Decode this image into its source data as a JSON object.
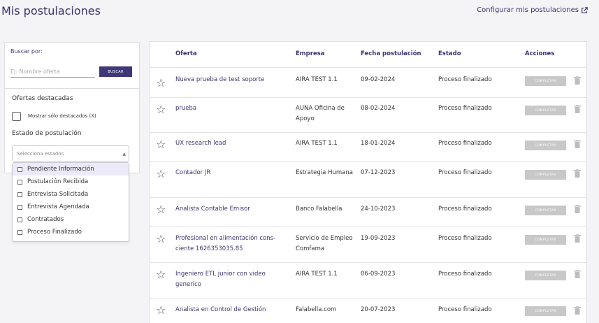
{
  "page": {
    "title": "Mis postulaciones",
    "config_link": "Configurar mis postulaciones"
  },
  "filters": {
    "search_label": "Buscar por:",
    "search_placeholder": "Ej: Nombre oferta",
    "search_button": "BUSCAR",
    "featured_title": "Ofertas destacadas",
    "featured_checkbox_label": "Mostrar sólo destacados (X)",
    "state_title": "Estado de postulación",
    "state_placeholder": "Selecciona estados",
    "state_options": [
      "Pendiente Información",
      "Postulación Recibida",
      "Entrevista Solicitada",
      "Entrevista Agendada",
      "Contratados",
      "Proceso Finalizado"
    ]
  },
  "table": {
    "headers": {
      "offer": "Oferta",
      "company": "Empresa",
      "date": "Fecha postulación",
      "state": "Estado",
      "actions": "Acciones"
    },
    "action_label": "COMPLETAR",
    "rows": [
      {
        "offer": "Nueva prueba de test soporte",
        "company": "AIRA TEST 1.1",
        "date": "09-02-2024",
        "state": "Proceso finalizado"
      },
      {
        "offer": "prueba",
        "company": "AUNA Oficina de Apoyo",
        "date": "08-02-2024",
        "state": "Proceso finalizado"
      },
      {
        "offer": "UX research lead",
        "company": "AIRA TEST 1.1",
        "date": "18-01-2024",
        "state": "Proceso finalizado"
      },
      {
        "offer": "Contador JR",
        "company": "Estrategia Humana",
        "date": "07-12-2023",
        "state": "Proceso finalizado"
      },
      {
        "offer": "Analista Contable Emisor",
        "company": "Banco Falabella",
        "date": "24-10-2023",
        "state": "Proceso finalizado"
      },
      {
        "offer": "Profesional en alimentación cons-ciente 1626353035.85",
        "company": "Servicio de Empleo Comfama",
        "date": "19-09-2023",
        "state": "Proceso finalizado"
      },
      {
        "offer": "Ingeniero ETL junior con video generico",
        "company": "AIRA TEST 1.1",
        "date": "06-09-2023",
        "state": "Proceso finalizado"
      },
      {
        "offer": "Analista en Control de Gestión",
        "company": "Falabella.com",
        "date": "20-07-2023",
        "state": "Proceso finalizado"
      }
    ]
  }
}
